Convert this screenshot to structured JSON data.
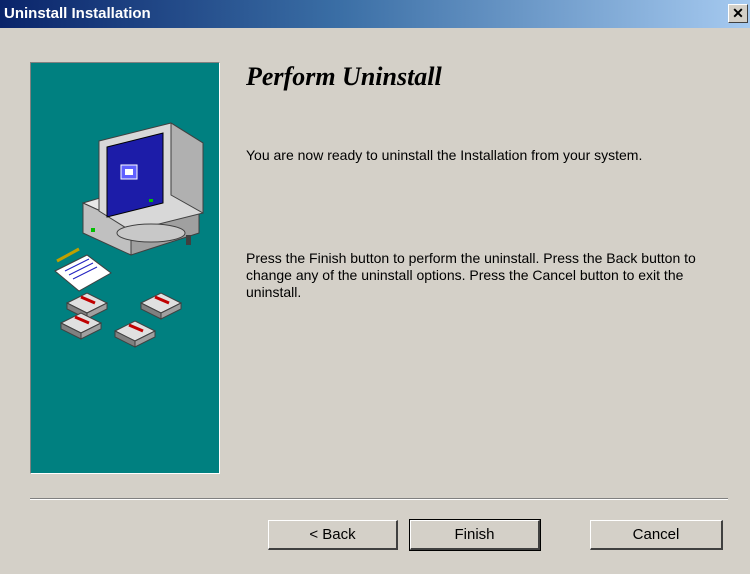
{
  "window": {
    "title": "Uninstall Installation",
    "close_glyph": "✕"
  },
  "content": {
    "heading": "Perform Uninstall",
    "paragraph1": "You are now ready to uninstall the  Installation from your system.",
    "paragraph2": "Press the Finish button to perform the uninstall. Press the Back button to change any of the uninstall options. Press the Cancel button to exit the uninstall."
  },
  "buttons": {
    "back": "< Back",
    "finish": "Finish",
    "cancel": "Cancel"
  },
  "sidebar": {
    "illustration": "computer-with-disks-icon",
    "background_color": "#008080"
  },
  "colors": {
    "titlebar_start": "#0a246a",
    "titlebar_end": "#a6caf0",
    "dialog_bg": "#d4d0c8"
  }
}
